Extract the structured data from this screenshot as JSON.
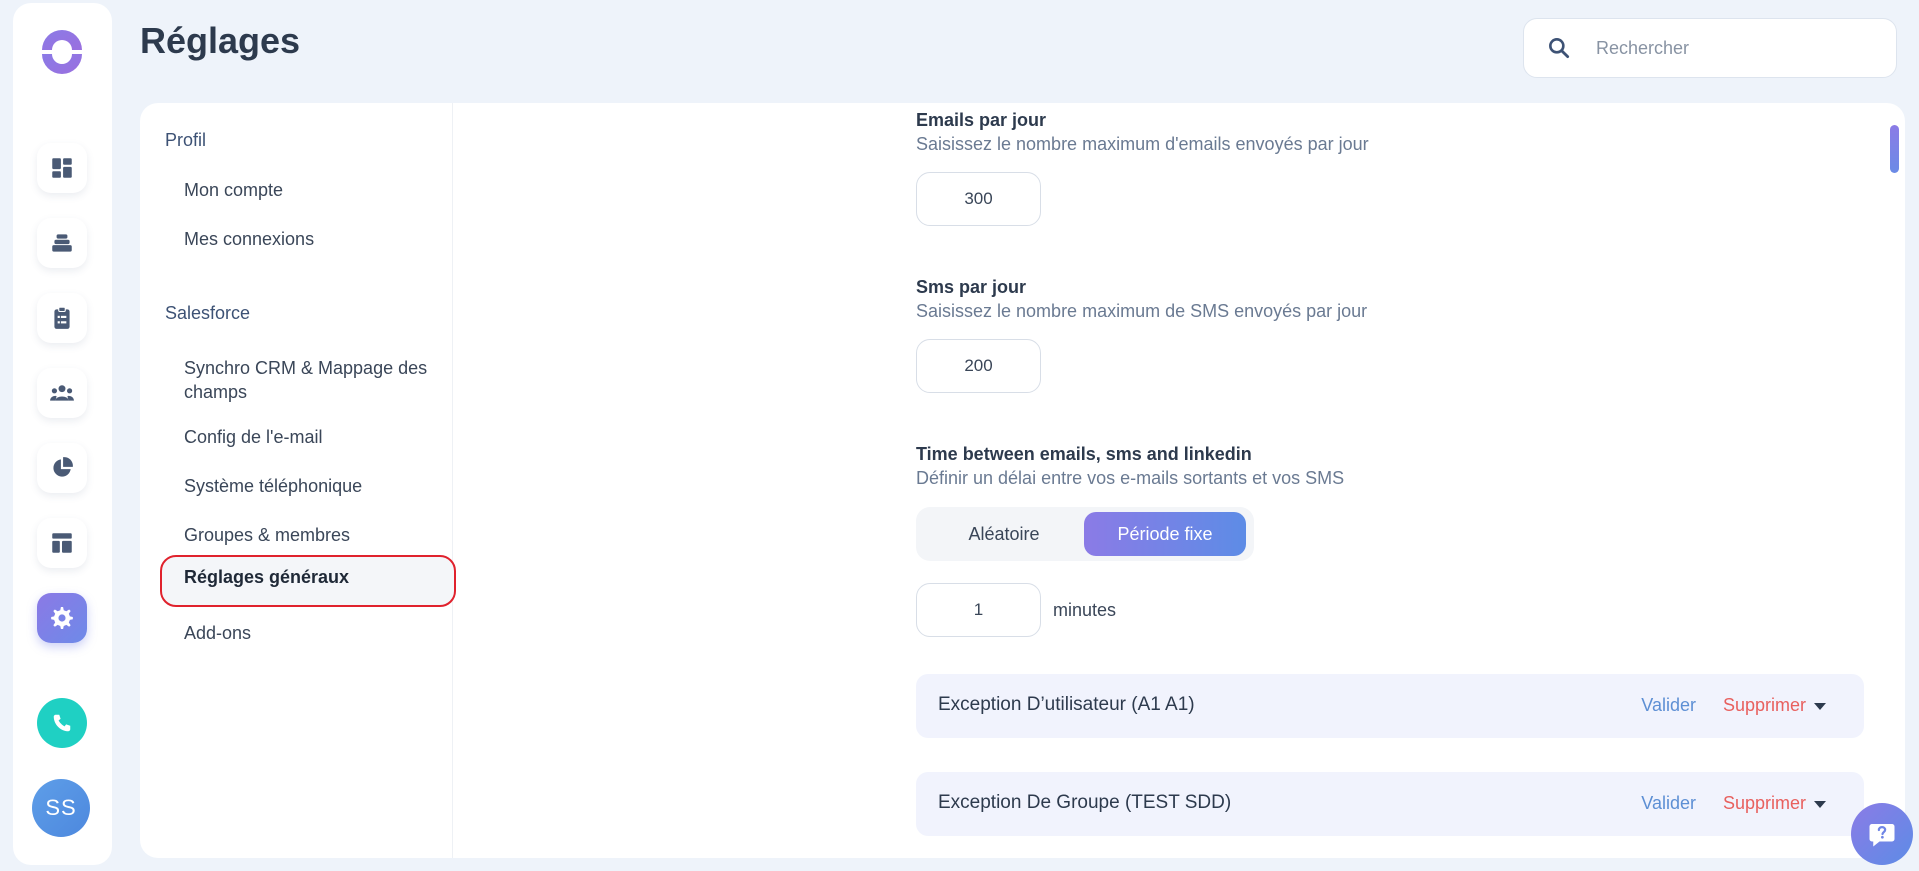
{
  "page": {
    "title": "Réglages"
  },
  "search": {
    "placeholder": "Rechercher"
  },
  "rail": {
    "items": [
      "dashboard-icon",
      "layers-icon",
      "clipboard-icon",
      "team-icon",
      "pie-chart-icon",
      "layout-icon",
      "gear-icon"
    ],
    "active": "gear-icon",
    "avatar_initials": "SS"
  },
  "settings_nav": {
    "groups": [
      {
        "label": "Profil",
        "items": [
          "Mon compte",
          "Mes connexions"
        ]
      },
      {
        "label": "Salesforce",
        "items": [
          "Synchro CRM & Mappage des champs",
          "Config de l'e-mail",
          "Système téléphonique",
          "Groupes & membres",
          "Réglages généraux",
          "Add-ons"
        ]
      }
    ],
    "active_item": "Réglages généraux"
  },
  "content": {
    "emails_per_day": {
      "title": "Emails par jour",
      "description": "Saisissez le nombre maximum d'emails envoyés par jour",
      "value": "300"
    },
    "sms_per_day": {
      "title": "Sms par jour",
      "description": "Saisissez le nombre maximum de SMS envoyés par jour",
      "value": "200"
    },
    "time_between": {
      "title": "Time between emails, sms and linkedin",
      "description": "Définir un délai entre vos e-mails sortants et vos SMS",
      "options": [
        "Aléatoire",
        "Période fixe"
      ],
      "selected": "Période fixe",
      "value": "1",
      "unit": "minutes"
    },
    "exceptions": [
      {
        "title": "Exception D’utilisateur (A1 A1)",
        "validate": "Valider",
        "delete": "Supprimer"
      },
      {
        "title": "Exception De Groupe (TEST SDD)",
        "validate": "Valider",
        "delete": "Supprimer"
      }
    ]
  },
  "colors": {
    "accent_gradient_start": "#8b7be6",
    "accent_gradient_end": "#5d8ce6",
    "phone": "#1fd0c3",
    "delete": "#e8605e",
    "validate": "#5d8fd4",
    "active_outline": "#e0222d"
  }
}
